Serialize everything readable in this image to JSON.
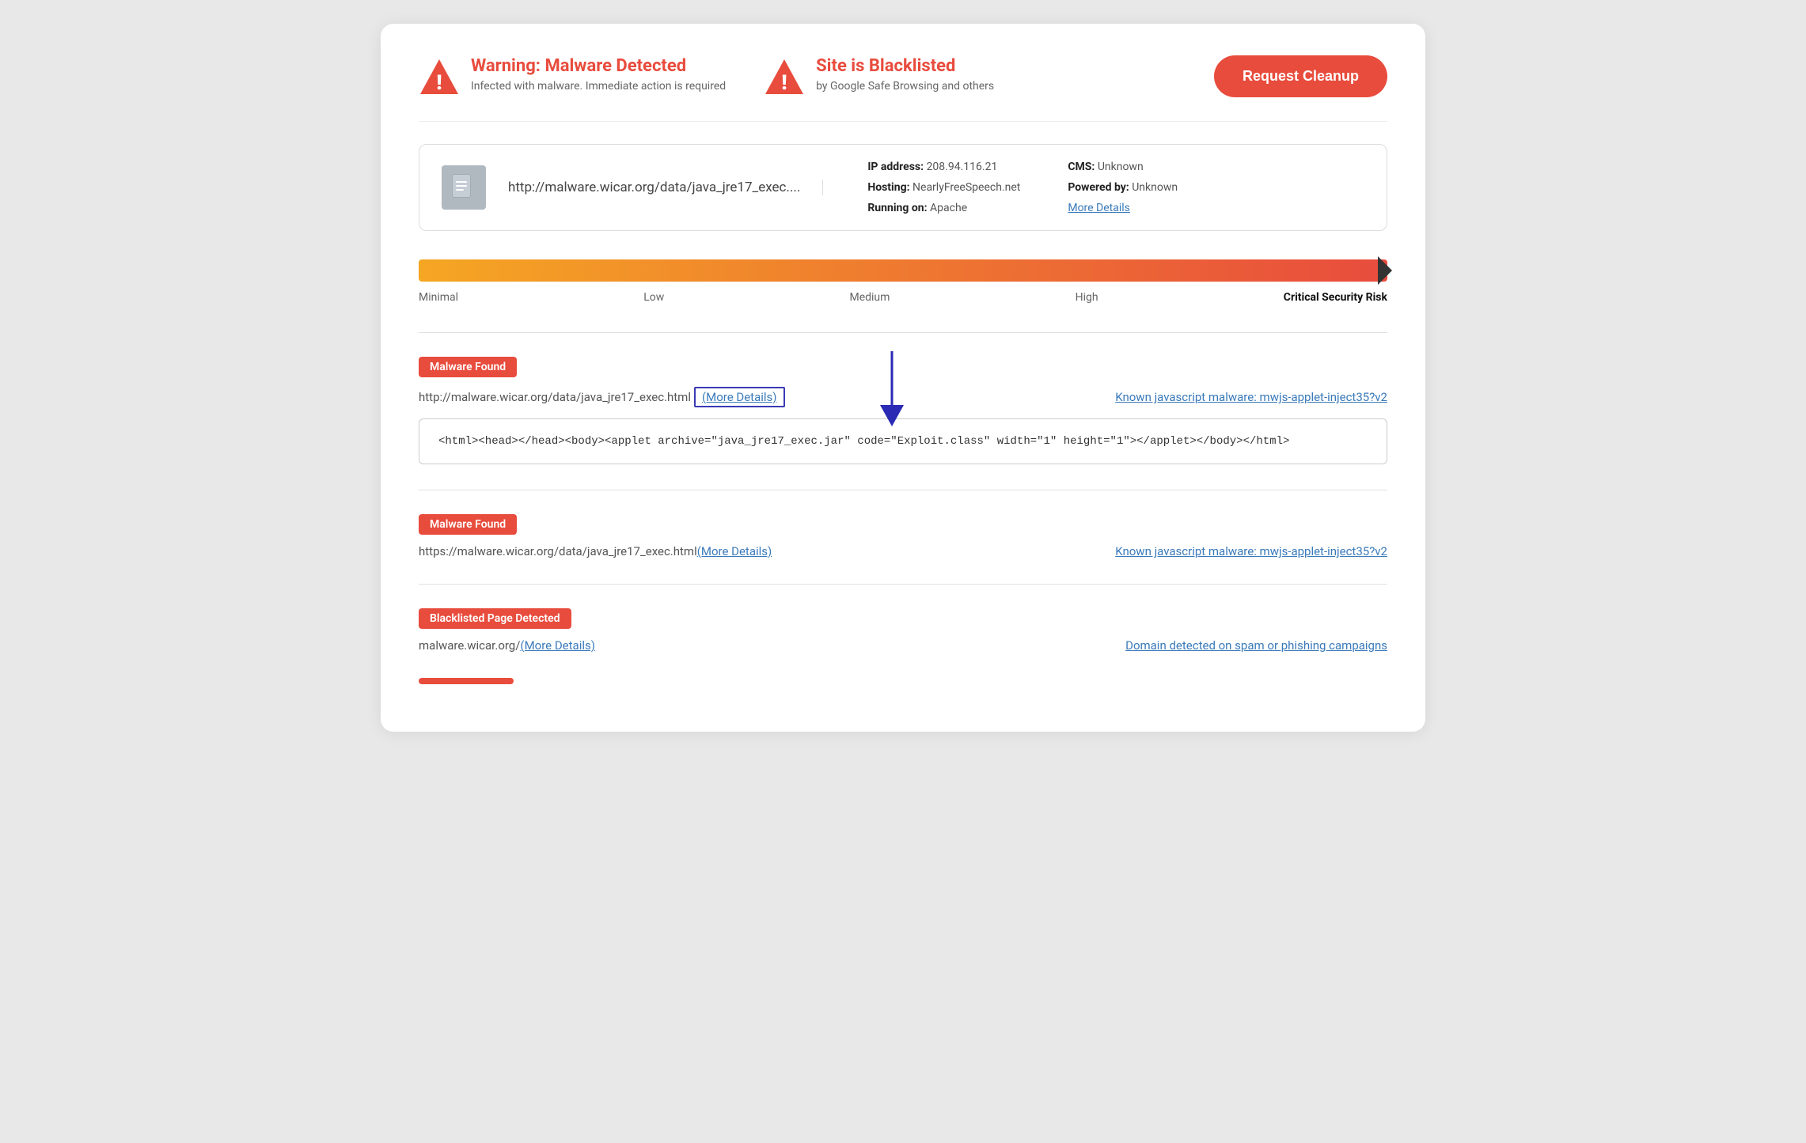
{
  "header": {
    "warning_title": "Warning: Malware Detected",
    "warning_sub": "Infected with malware. Immediate action is required",
    "blacklist_title": "Site is Blacklisted",
    "blacklist_sub": "by Google Safe Browsing and others",
    "cleanup_button": "Request Cleanup"
  },
  "site_info": {
    "url": "http://malware.wicar.org/data/java_jre17_exec....",
    "ip_label": "IP address:",
    "ip_value": "208.94.116.21",
    "hosting_label": "Hosting:",
    "hosting_value": "NearlyFreeSpeech.net",
    "running_label": "Running on:",
    "running_value": "Apache",
    "cms_label": "CMS:",
    "cms_value": "Unknown",
    "powered_label": "Powered by:",
    "powered_value": "Unknown",
    "more_details": "More Details"
  },
  "risk_bar": {
    "labels": {
      "minimal": "Minimal",
      "low": "Low",
      "medium": "Medium",
      "high": "High",
      "critical": "Critical Security Risk"
    }
  },
  "findings": [
    {
      "badge": "Malware Found",
      "url": "http://malware.wicar.org/data/java_jre17_exec.html",
      "more_details_label": "(More Details)",
      "known_label": "Known javascript malware: mwjs-applet-inject35?v2",
      "code": "<html><head></head><body><applet archive=\"java_jre17_exec.jar\" code=\"Exploit.class\" width=\"1\" height=\"1\"></applet></body></html>",
      "has_code": true,
      "has_arrow": true
    },
    {
      "badge": "Malware Found",
      "url": "https://malware.wicar.org/data/java_jre17_exec.html",
      "more_details_label": "(More Details)",
      "known_label": "Known javascript malware: mwjs-applet-inject35?v2",
      "has_code": false,
      "has_arrow": false
    },
    {
      "badge": "Blacklisted Page Detected",
      "url": "malware.wicar.org/",
      "more_details_label": "(More Details)",
      "known_label": "Domain detected on spam or phishing campaigns",
      "has_code": false,
      "has_arrow": false,
      "is_blacklist": true
    }
  ]
}
